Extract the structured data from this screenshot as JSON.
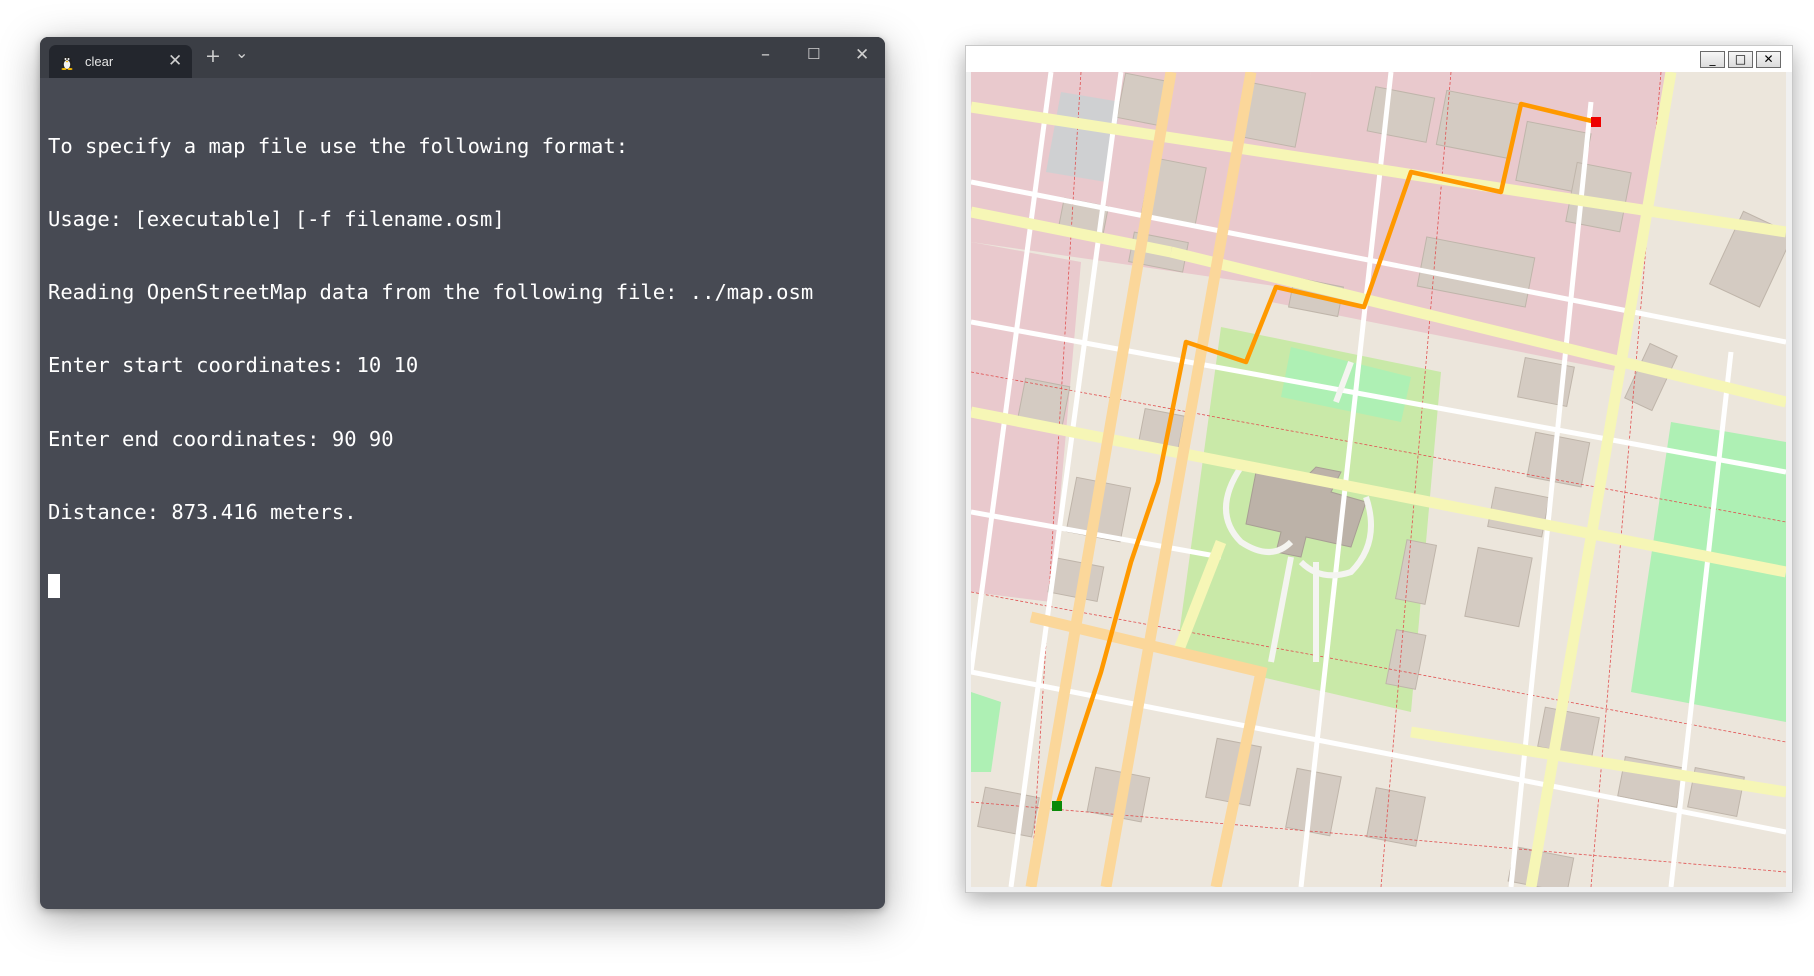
{
  "terminal": {
    "tab_title": "clear",
    "tab_icon": "linux-tux-icon",
    "new_tab_symbol": "+",
    "dropdown_symbol": "⌄",
    "lines": [
      "To specify a map file use the following format:",
      "Usage: [executable] [-f filename.osm]",
      "Reading OpenStreetMap data from the following file: ../map.osm",
      "Enter start coordinates: 10 10",
      "Enter end coordinates: 90 90",
      "Distance: 873.416 meters."
    ],
    "colors": {
      "background": "#474a53",
      "titlebar": "#3b3e45",
      "tab": "#23262d",
      "text": "#ffffff"
    }
  },
  "map_window": {
    "buttons": {
      "minimize": "_",
      "maximize": "□",
      "close": "✕"
    },
    "start_marker_color": "#0a8a0a",
    "end_marker_color": "#ee0000",
    "route_color": "#ff9900",
    "colors": {
      "land": "#ece6dc",
      "residential": "#e9c9cd",
      "park": "#c9e9a8",
      "garden": "#aef0b4",
      "building": "#d4cbc2",
      "primary_road": "#fbd79a",
      "secondary_road": "#f6f6b6",
      "street": "#ffffff",
      "boundary": "#e05050"
    }
  }
}
